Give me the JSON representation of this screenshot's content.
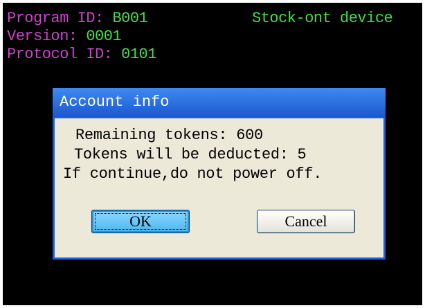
{
  "header": {
    "program_id_label": "Program ID:",
    "program_id_value": "B001",
    "version_label": "Version:",
    "version_value": "0001",
    "protocol_id_label": "Protocol ID:",
    "protocol_id_value": "0101",
    "device_name": "Stock-ont device"
  },
  "dialog": {
    "title": "Account info",
    "remaining_tokens_line": "Remaining tokens: 600",
    "deducted_tokens_line": "Tokens will be deducted: 5",
    "warning_line": "If continue,do not power off.",
    "ok_label": "OK",
    "cancel_label": "Cancel"
  },
  "colors": {
    "screen_background": "#000000",
    "label_magenta": "#d040d0",
    "value_green": "#40e040",
    "dialog_title_blue": "#1f63d8",
    "dialog_body": "#ece9d8",
    "ok_button_blue": "#49b8f0"
  }
}
